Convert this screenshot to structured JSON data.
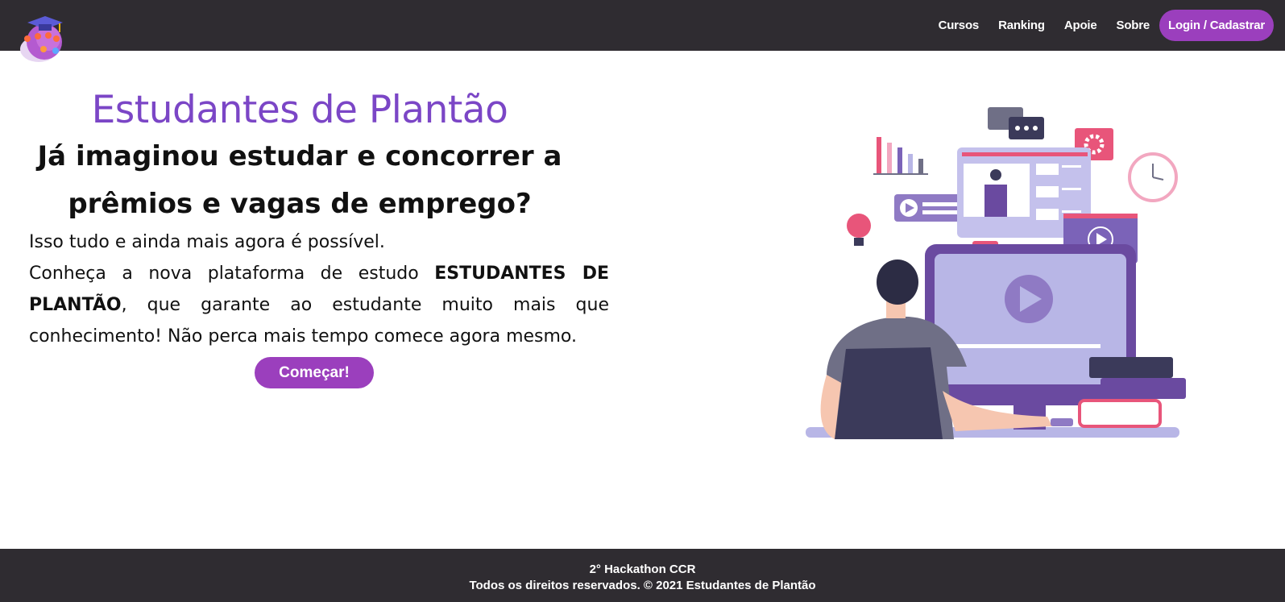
{
  "nav": {
    "links": [
      "Cursos",
      "Ranking",
      "Apoie",
      "Sobre"
    ],
    "login_label": "Login / Cadastrar"
  },
  "hero": {
    "title": "Estudantes de Plantão",
    "subtitle": "Já imaginou estudar e concorrer a prêmios e vagas de emprego?",
    "line1": "Isso tudo e ainda mais agora é possível.",
    "line2_start": "Conheça a nova plataforma de estudo",
    "line2_bold": "ESTUDANTES DE PLANTÃO",
    "line2_end": ", que garante ao estudante muito mais que conhecimento! Não perca mais tempo comece agora mesmo.",
    "button_label": "Começar!"
  },
  "footer": {
    "line1": "2° Hackathon CCR",
    "line2": "Todos os direitos reservados. © 2021 Estudantes de Plantão"
  },
  "icons": {
    "logo": "graduation-logo-icon",
    "illustration": "student-online-learning-illustration"
  },
  "colors": {
    "navbar": "#2f2c31",
    "accent": "#9b3fbd",
    "title": "#7b46c6"
  }
}
